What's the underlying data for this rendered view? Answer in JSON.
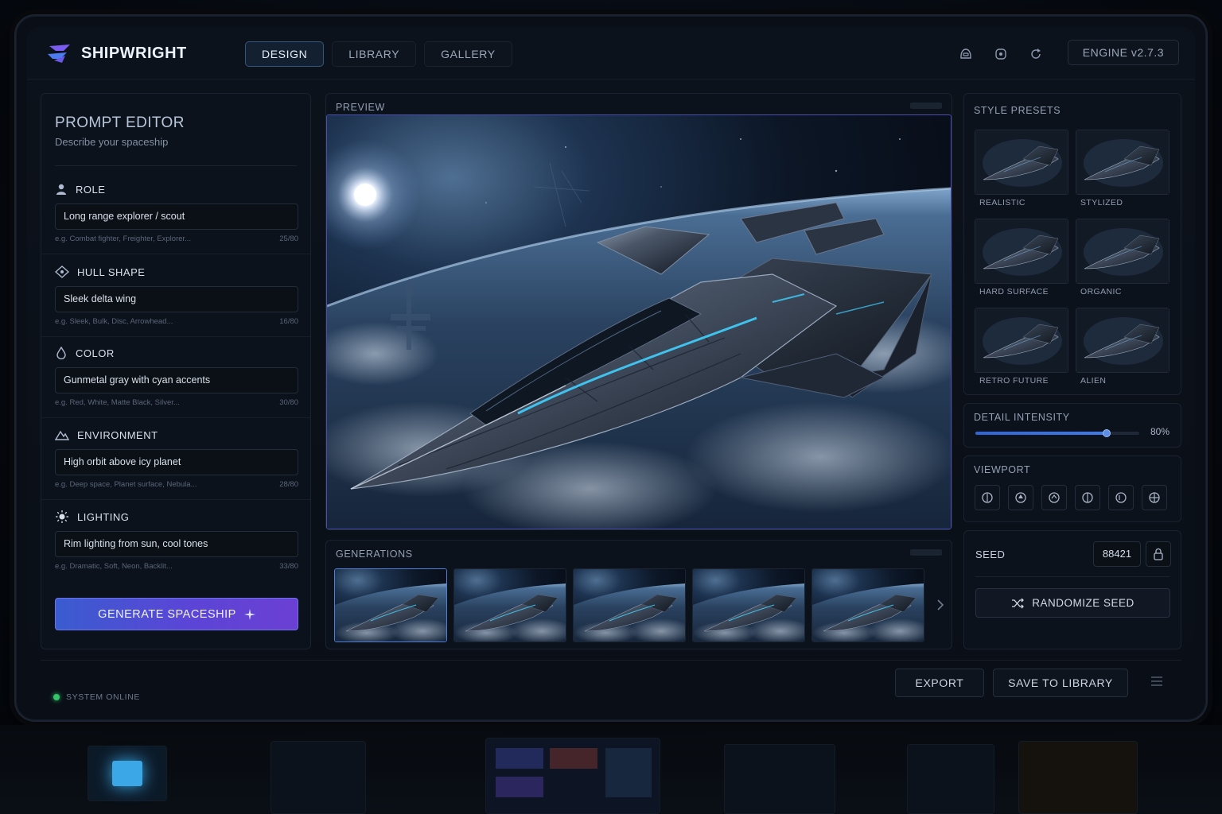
{
  "app": {
    "name": "SHIPWRIGHT",
    "engine_badge": "ENGINE v2.7.3"
  },
  "nav": {
    "tabs": [
      {
        "label": "DESIGN",
        "active": true
      },
      {
        "label": "LIBRARY",
        "active": false
      },
      {
        "label": "GALLERY",
        "active": false
      }
    ],
    "icons": [
      "helmet-icon",
      "settings-icon",
      "refresh-icon"
    ]
  },
  "prompt_editor": {
    "title": "PROMPT EDITOR",
    "subtitle": "Describe your spaceship",
    "fields": [
      {
        "icon": "user-icon",
        "label": "ROLE",
        "value": "Long range explorer / scout",
        "hint": "e.g. Combat fighter, Freighter, Explorer...",
        "count": "25/80"
      },
      {
        "icon": "hull-icon",
        "label": "HULL SHAPE",
        "value": "Sleek delta wing",
        "hint": "e.g. Sleek, Bulk, Disc, Arrowhead...",
        "count": "16/80"
      },
      {
        "icon": "droplet-icon",
        "label": "COLOR",
        "value": "Gunmetal gray with cyan accents",
        "hint": "e.g. Red, White, Matte Black, Silver...",
        "count": "30/80"
      },
      {
        "icon": "mountain-icon",
        "label": "ENVIRONMENT",
        "value": "High orbit above icy planet",
        "hint": "e.g. Deep space, Planet surface, Nebula...",
        "count": "28/80"
      },
      {
        "icon": "sun-icon",
        "label": "LIGHTING",
        "value": "Rim lighting from sun, cool tones",
        "hint": "e.g. Dramatic, Soft, Neon, Backlit...",
        "count": "33/80"
      }
    ],
    "generate_button": "GENERATE SPACESHIP"
  },
  "preview": {
    "label": "PREVIEW"
  },
  "generations": {
    "label": "GENERATIONS",
    "count": 5,
    "selected_index": 0
  },
  "style_presets": {
    "label": "STYLE PRESETS",
    "items": [
      "REALISTIC",
      "STYLIZED",
      "HARD SURFACE",
      "ORGANIC",
      "RETRO FUTURE",
      "ALIEN"
    ]
  },
  "detail_intensity": {
    "label": "DETAIL INTENSITY",
    "value_text": "80%",
    "fraction": 0.8
  },
  "viewport": {
    "label": "VIEWPORT",
    "buttons": [
      "view-front-icon",
      "view-top-icon",
      "view-up-icon",
      "view-side-icon",
      "view-rear-icon",
      "view-free-icon"
    ]
  },
  "seed": {
    "label": "SEED",
    "value": "88421",
    "randomize_button": "RANDOMIZE SEED"
  },
  "footer": {
    "status": "SYSTEM ONLINE",
    "export_button": "EXPORT",
    "save_button": "SAVE TO LIBRARY"
  },
  "colors": {
    "accent": "#4f7fd6",
    "generate_gradient_start": "#3a5cd0",
    "generate_gradient_end": "#6b3fd3",
    "status_online": "#34c46a"
  }
}
